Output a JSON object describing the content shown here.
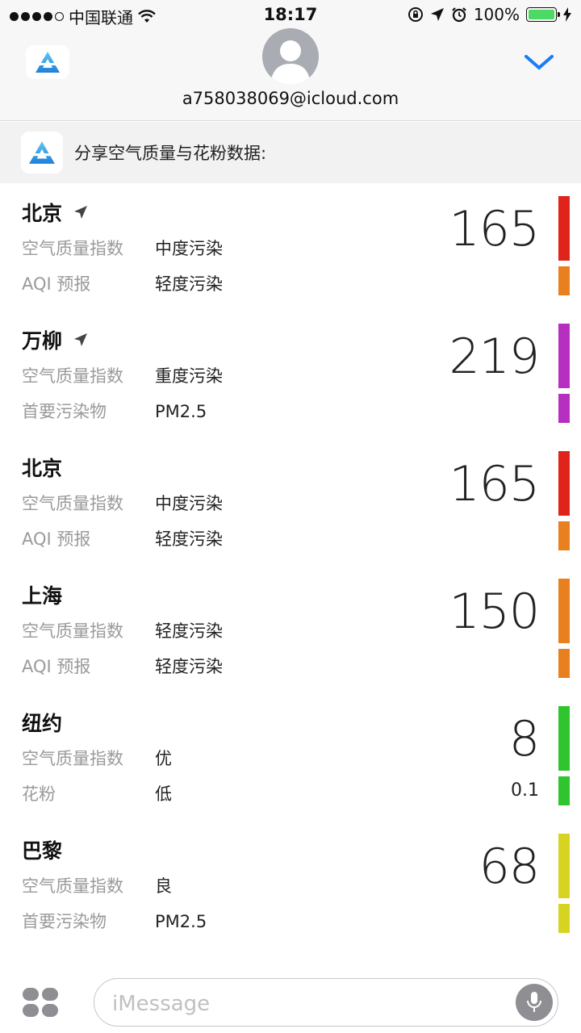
{
  "status_bar": {
    "carrier": "中国联通",
    "time": "18:17",
    "battery": "100%"
  },
  "header": {
    "contact": "a758038069@icloud.com"
  },
  "share": {
    "title": "分享空气质量与花粉数据:"
  },
  "cities": [
    {
      "name": "北京",
      "located": true,
      "row1_key": "空气质量指数",
      "row1_val": "中度污染",
      "row2_key": "AQI 预报",
      "row2_val": "轻度污染",
      "value": "165",
      "secondary": "",
      "top_color": "#e0231b",
      "bottom_color": "#e8801f"
    },
    {
      "name": "万柳",
      "located": true,
      "row1_key": "空气质量指数",
      "row1_val": "重度污染",
      "row2_key": "首要污染物",
      "row2_val": "PM2.5",
      "value": "219",
      "secondary": "",
      "top_color": "#b62fc0",
      "bottom_color": "#b62fc0"
    },
    {
      "name": "北京",
      "located": false,
      "row1_key": "空气质量指数",
      "row1_val": "中度污染",
      "row2_key": "AQI 预报",
      "row2_val": "轻度污染",
      "value": "165",
      "secondary": "",
      "top_color": "#e0231b",
      "bottom_color": "#e8801f"
    },
    {
      "name": "上海",
      "located": false,
      "row1_key": "空气质量指数",
      "row1_val": "轻度污染",
      "row2_key": "AQI 预报",
      "row2_val": "轻度污染",
      "value": "150",
      "secondary": "",
      "top_color": "#e8801f",
      "bottom_color": "#e8801f"
    },
    {
      "name": "纽约",
      "located": false,
      "row1_key": "空气质量指数",
      "row1_val": "优",
      "row2_key": "花粉",
      "row2_val": "低",
      "value": "8",
      "secondary": "0.1",
      "top_color": "#2ec52e",
      "bottom_color": "#2ec52e"
    },
    {
      "name": "巴黎",
      "located": false,
      "row1_key": "空气质量指数",
      "row1_val": "良",
      "row2_key": "首要污染物",
      "row2_val": "PM2.5",
      "value": "68",
      "secondary": "",
      "top_color": "#d6d420",
      "bottom_color": "#d6d420"
    }
  ],
  "input": {
    "placeholder": "iMessage"
  },
  "icons": {
    "signal": "signal-dots-icon",
    "wifi": "wifi-icon",
    "lock": "orientation-lock-icon",
    "location": "location-arrow-icon",
    "alarm": "alarm-icon",
    "charging": "charging-bolt-icon",
    "app": "air-app-logo-icon",
    "avatar": "person-silhouette-icon",
    "collapse": "chevron-down-icon",
    "apps": "app-drawer-icon",
    "mic": "microphone-icon"
  }
}
